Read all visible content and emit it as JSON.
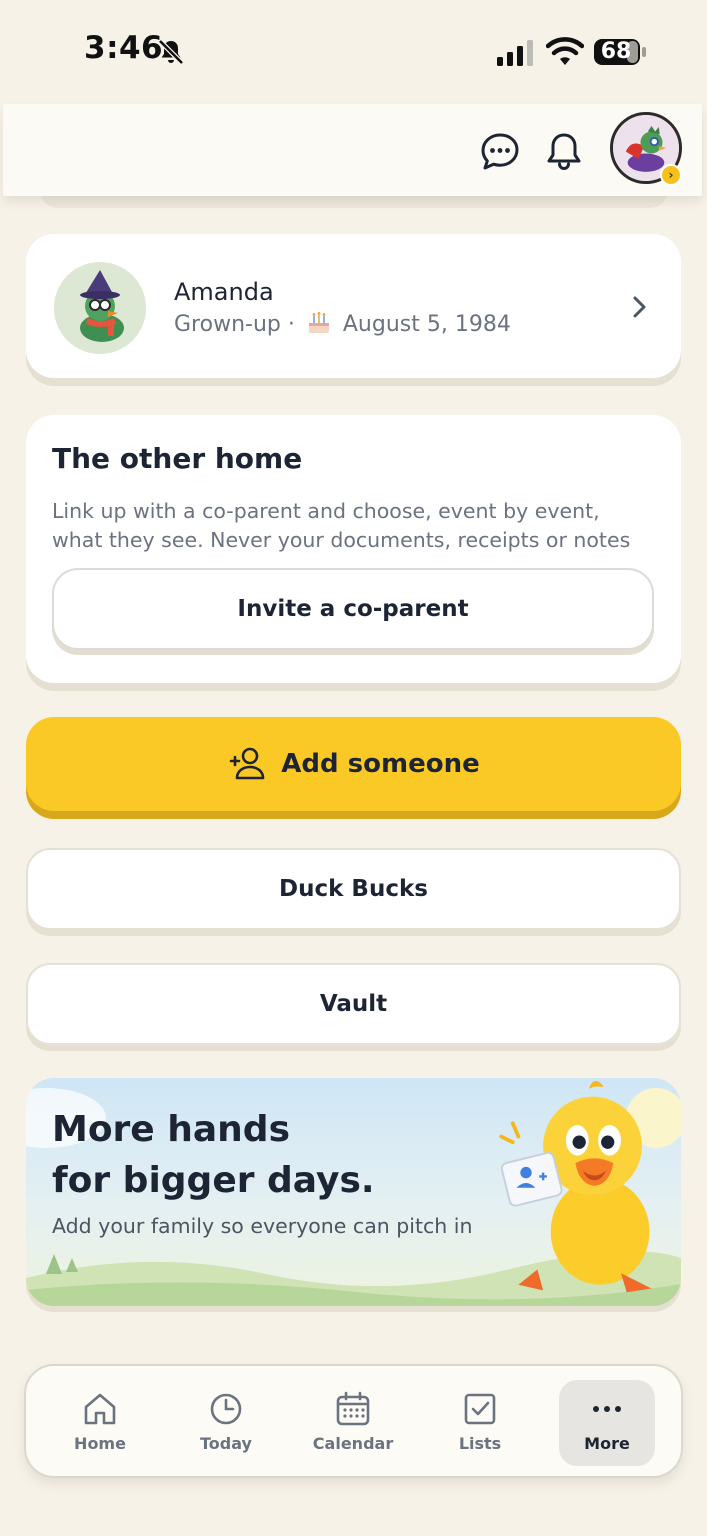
{
  "status_bar": {
    "time": "3:46",
    "battery": "68"
  },
  "header": {
    "icons": [
      "chat-bubble-icon",
      "bell-icon"
    ],
    "avatar_badge": "›"
  },
  "profile": {
    "name": "Amanda",
    "role": "Grown-up",
    "separator": "·",
    "birthday": "August 5, 1984"
  },
  "other_home": {
    "title": "The other home",
    "description": "Link up with a co-parent and choose, event by event, what they see. Never your documents, receipts or notes",
    "invite_label": "Invite a co-parent"
  },
  "actions": {
    "add_someone": "Add someone",
    "duck_bucks": "Duck Bucks",
    "vault": "Vault"
  },
  "promo": {
    "title_line1": "More hands",
    "title_line2": "for bigger days.",
    "subtitle": "Add your family so everyone can pitch in"
  },
  "tabs": [
    {
      "label": "Home",
      "icon": "house-icon"
    },
    {
      "label": "Today",
      "icon": "clock-icon"
    },
    {
      "label": "Calendar",
      "icon": "calendar-icon"
    },
    {
      "label": "Lists",
      "icon": "checkbox-icon"
    },
    {
      "label": "More",
      "icon": "ellipsis-icon",
      "selected": true
    }
  ],
  "colors": {
    "accent_yellow": "#fbc925",
    "background": "#f6f2e7",
    "text": "#1d2433"
  }
}
